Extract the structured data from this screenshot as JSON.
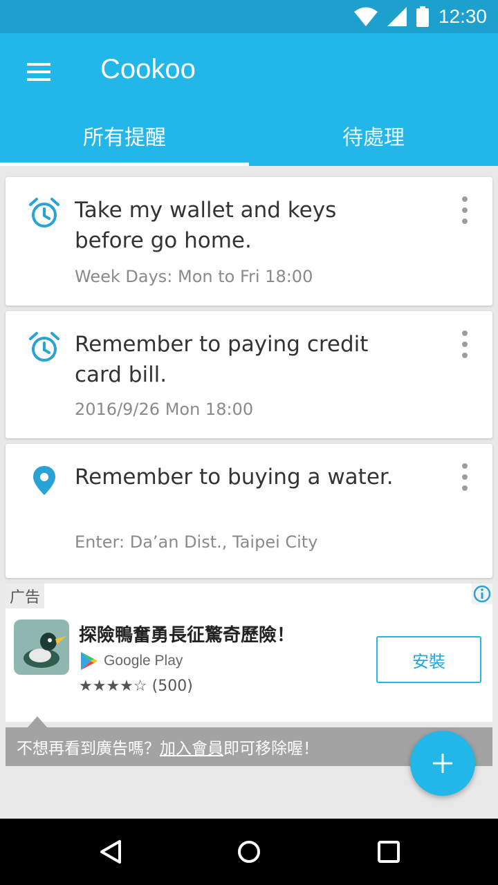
{
  "status_bar": {
    "time": "12:30"
  },
  "app": {
    "title": "Cookoo"
  },
  "tabs": [
    {
      "label": "所有提醒",
      "active": true
    },
    {
      "label": "待處理",
      "active": false
    }
  ],
  "reminders": [
    {
      "icon": "alarm-clock-icon",
      "title": "Take my wallet and keys before go home.",
      "subtitle": "Week Days: Mon to  Fri 18:00"
    },
    {
      "icon": "alarm-clock-icon",
      "title": "Remember to paying credit card bill.",
      "subtitle": "2016/9/26 Mon 18:00"
    },
    {
      "icon": "location-pin-icon",
      "title": "Remember to buying a water.",
      "subtitle": "Enter: Da’an Dist., Taipei City"
    }
  ],
  "ad": {
    "label": "广告",
    "title": "探險鴨奮勇長征驚奇歷險！",
    "store": "Google Play",
    "stars": "★★★★☆",
    "reviews": "(500)",
    "install_label": "安裝"
  },
  "promo": {
    "prefix": "不想再看到廣告嗎？",
    "link": "加入會員",
    "suffix": "即可移除喔！"
  },
  "colors": {
    "primary": "#22b6e9",
    "status": "#1ea0cf",
    "accent_icon": "#29a3d6"
  }
}
